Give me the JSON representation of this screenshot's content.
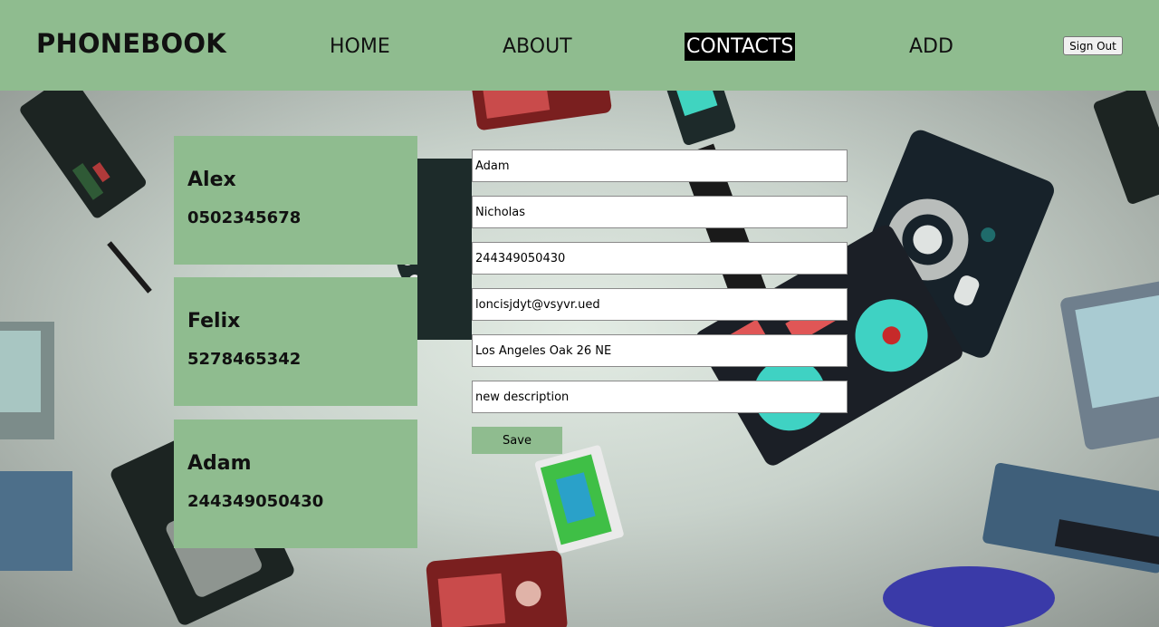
{
  "header": {
    "brand": "PHONEBOOK",
    "nav": [
      "HOME",
      "ABOUT",
      "CONTACTS",
      "ADD"
    ],
    "active_nav": "CONTACTS",
    "signout_label": "Sign Out"
  },
  "contacts": [
    {
      "name": "Alex",
      "phone": "0502345678"
    },
    {
      "name": "Felix",
      "phone": "5278465342"
    },
    {
      "name": "Adam",
      "phone": "244349050430"
    }
  ],
  "form": {
    "first_name": "Adam",
    "last_name": "Nicholas",
    "phone": "244349050430",
    "email": "loncisjdyt@vsyvr.ued",
    "address": "Los Angeles Oak 26 NE",
    "description": "new description",
    "save_label": "Save"
  },
  "colors": {
    "accent": "#8fbc8f",
    "nav_active_bg": "#000000",
    "nav_active_text": "#ffffff"
  }
}
